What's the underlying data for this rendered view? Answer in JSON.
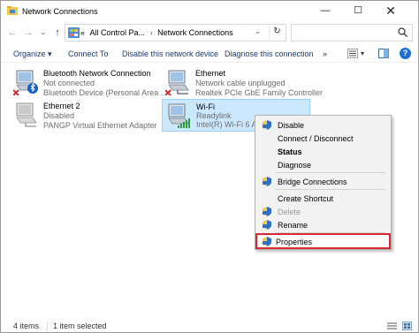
{
  "window": {
    "title": "Network Connections",
    "minimize_glyph": "—",
    "maximize_glyph": "☐",
    "close_glyph": "✕"
  },
  "address": {
    "back_glyph": "←",
    "forward_glyph": "→",
    "history_glyph": "⌄",
    "up_glyph": "↑",
    "prefix": "«",
    "crumb1": "All Control Pa...",
    "crumb_sep": "›",
    "crumb2": "Network Connections",
    "dropdown_glyph": "⌄",
    "refresh_glyph": "↻",
    "search_placeholder": ""
  },
  "toolbar": {
    "organize": "Organize ▾",
    "connect_to": "Connect To",
    "disable": "Disable this network device",
    "diagnose": "Diagnose this connection",
    "more": "»",
    "view_dropdown": "▾",
    "help": "?"
  },
  "connections": [
    {
      "name": "Bluetooth Network Connection",
      "status": "Not connected",
      "device": "Bluetooth Device (Personal Area ..."
    },
    {
      "name": "Ethernet",
      "status": "Network cable unplugged",
      "device": "Realtek PCIe GbE Family Controller"
    },
    {
      "name": "Ethernet 2",
      "status": "Disabled",
      "device": "PANGP Virtual Ethernet Adapter"
    },
    {
      "name": "Wi-Fi",
      "status": "Readylink",
      "device": "Intel(R) Wi-Fi 6 AX2"
    }
  ],
  "context_menu": {
    "disable": "Disable",
    "connect_disconnect": "Connect / Disconnect",
    "status": "Status",
    "diagnose": "Diagnose",
    "bridge": "Bridge Connections",
    "shortcut": "Create Shortcut",
    "delete": "Delete",
    "rename": "Rename",
    "properties": "Properties"
  },
  "statusbar": {
    "count": "4 items",
    "selected": "1 item selected"
  },
  "colors": {
    "selection_bg": "#cce8ff",
    "highlight_border": "#d42a32",
    "link_text": "#1a3b6c",
    "help_blue": "#1e6fd2"
  }
}
